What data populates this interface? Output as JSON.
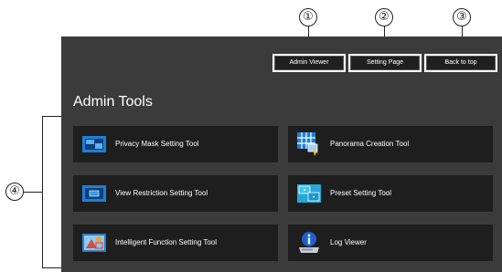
{
  "callouts": [
    "①",
    "②",
    "③",
    "④"
  ],
  "header": {
    "admin_viewer_label": "Admin Viewer",
    "setting_page_label": "Setting Page",
    "back_to_top_label": "Back to top"
  },
  "section": {
    "title": "Admin Tools"
  },
  "tools": [
    {
      "label": "Privacy Mask Setting Tool",
      "icon": "privacy-mask-icon"
    },
    {
      "label": "Panorama Creation Tool",
      "icon": "panorama-grid-icon"
    },
    {
      "label": "View Restriction Setting Tool",
      "icon": "view-restriction-icon"
    },
    {
      "label": "Preset Setting Tool",
      "icon": "preset-icon"
    },
    {
      "label": "Intelligent Function Setting Tool",
      "icon": "intelligent-function-icon"
    },
    {
      "label": "Log Viewer",
      "icon": "log-viewer-icon"
    }
  ],
  "colors": {
    "panel_bg": "#3b3b3b",
    "button_bg": "#1e1e1e",
    "icon_blue": "#1e7fd6",
    "text": "#ffffff"
  }
}
